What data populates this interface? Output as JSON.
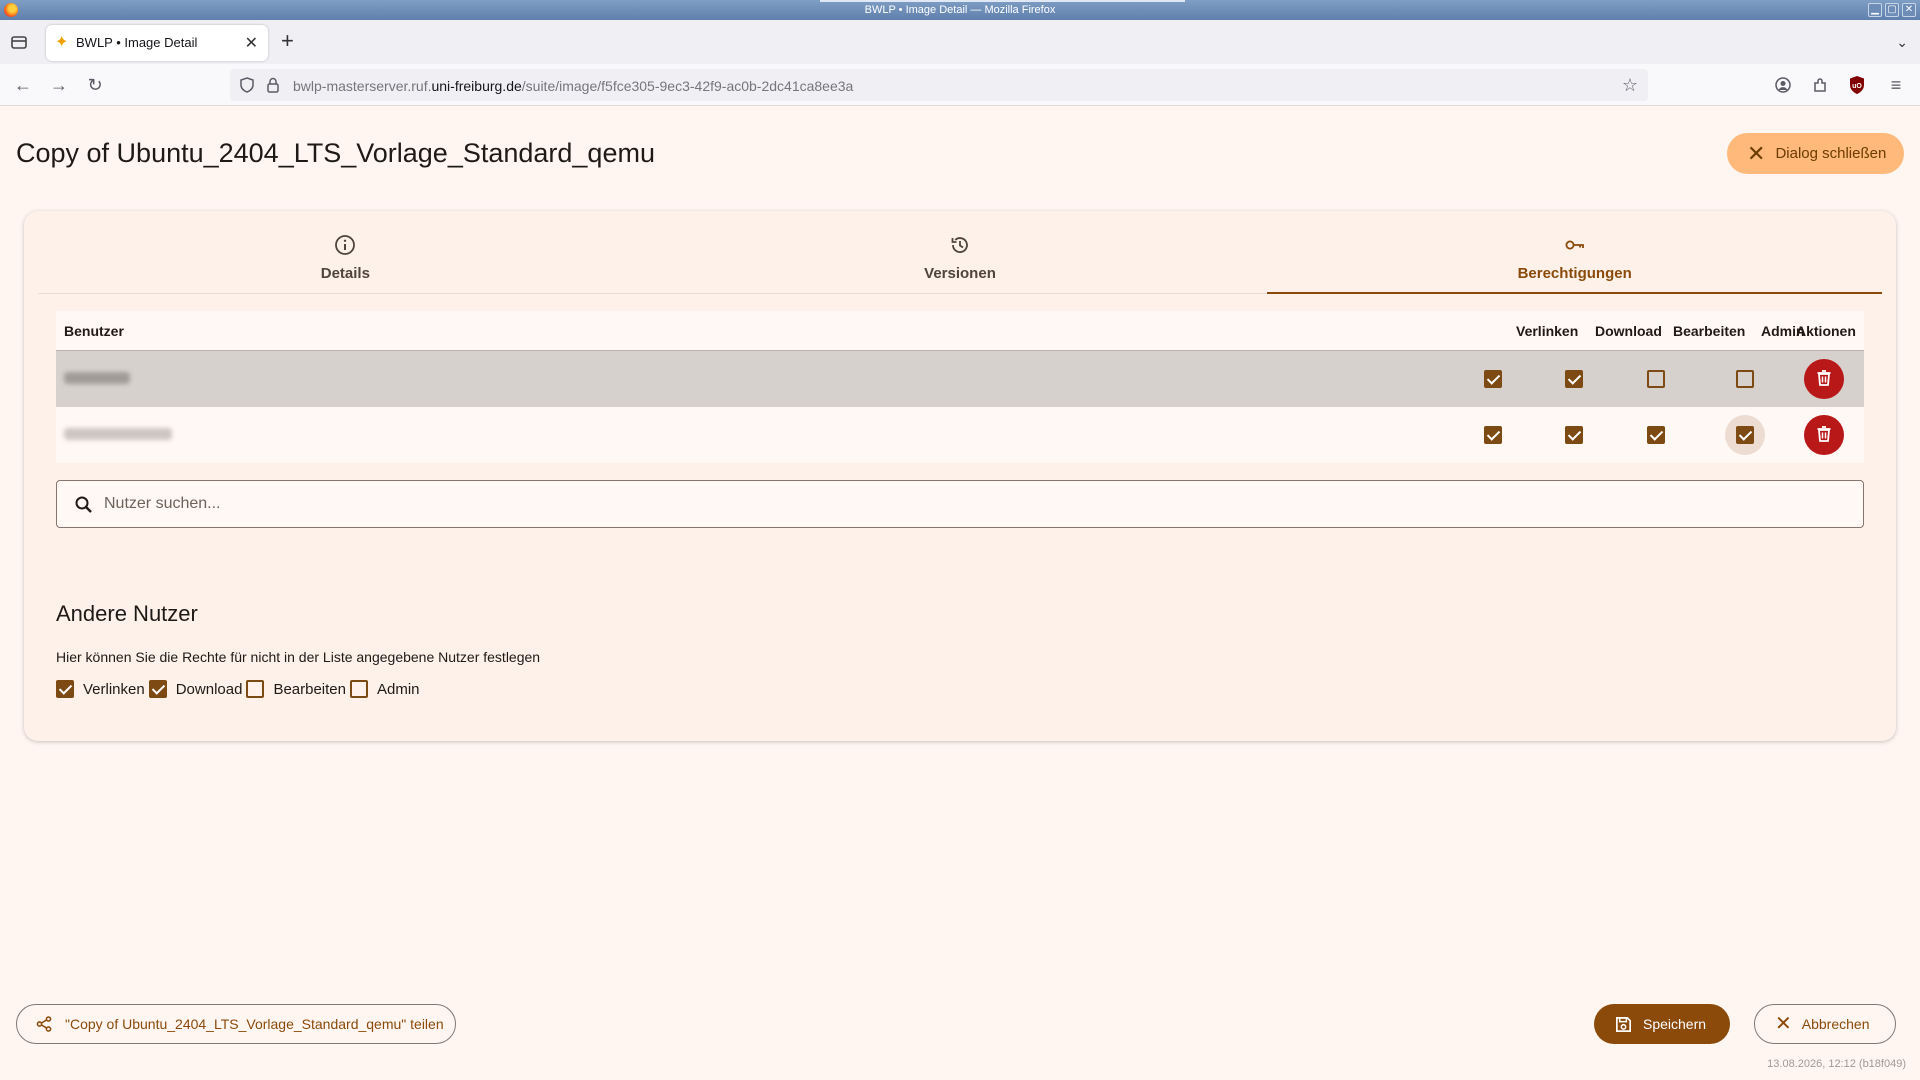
{
  "window": {
    "title": "BWLP • Image Detail — Mozilla Firefox",
    "controls": [
      "▁",
      "▢",
      "✕"
    ]
  },
  "browser": {
    "tab_label": "BWLP • Image Detail",
    "url_plain": "bwlp-masterserver.ruf.",
    "url_domain": "uni-freiburg.de",
    "url_path": "/suite/image/f5fce305-9ec3-42f9-ac0b-2dc41ca8ee3a"
  },
  "page": {
    "title": "Copy of Ubuntu_2404_LTS_Vorlage_Standard_qemu",
    "close_dialog_label": "Dialog schließen"
  },
  "tabs": [
    {
      "label": "Details",
      "icon": "info-icon",
      "active": false
    },
    {
      "label": "Versionen",
      "icon": "history-icon",
      "active": false
    },
    {
      "label": "Berechtigungen",
      "icon": "key-icon",
      "active": true
    }
  ],
  "permissions_table": {
    "headers": {
      "user": "Benutzer",
      "link": "Verlinken",
      "download": "Download",
      "edit": "Bearbeiten",
      "admin": "Admin",
      "actions": "Aktionen"
    },
    "rows": [
      {
        "user": "",
        "link": true,
        "download": true,
        "edit": false,
        "admin": false,
        "highlighted": true
      },
      {
        "user": "",
        "link": true,
        "download": true,
        "edit": true,
        "admin": true,
        "highlighted": false
      }
    ]
  },
  "search": {
    "placeholder": "Nutzer suchen...",
    "value": ""
  },
  "other_users": {
    "heading": "Andere Nutzer",
    "description": "Hier können Sie die Rechte für nicht in der Liste angegebene Nutzer festlegen",
    "options": [
      {
        "label": "Verlinken",
        "checked": true
      },
      {
        "label": "Download",
        "checked": true
      },
      {
        "label": "Bearbeiten",
        "checked": false
      },
      {
        "label": "Admin",
        "checked": false
      }
    ]
  },
  "footer": {
    "share_label": "\"Copy of Ubuntu_2404_LTS_Vorlage_Standard_qemu\" teilen",
    "save_label": "Speichern",
    "cancel_label": "Abbrechen",
    "version": "13.08.2026, 12:12 (b18f049)"
  },
  "colors": {
    "accent": "#8b4a0a",
    "danger": "#b91818",
    "close_button": "#ffb97a",
    "background": "#fff6f2"
  }
}
